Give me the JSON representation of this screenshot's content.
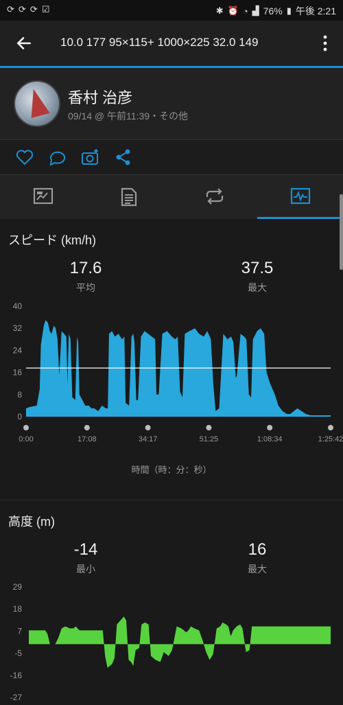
{
  "status_bar": {
    "left_icons": [
      "sync-icon",
      "sync-icon",
      "sync-icon",
      "checkbox-icon"
    ],
    "battery": "76%",
    "time": "午後 2:21"
  },
  "app_bar": {
    "title": "10.0  177   95×115+    1000×225  32.0  149"
  },
  "profile": {
    "name": "香村 治彦",
    "meta": "09/14 @ 午前11:39・その他"
  },
  "actions": [
    "like-icon",
    "comment-icon",
    "add-photo-icon",
    "share-icon"
  ],
  "tabs": [
    {
      "name": "overview",
      "icon": "map-icon",
      "active": false
    },
    {
      "name": "details",
      "icon": "document-icon",
      "active": false
    },
    {
      "name": "laps",
      "icon": "loop-icon",
      "active": false
    },
    {
      "name": "charts",
      "icon": "chart-icon",
      "active": true
    }
  ],
  "colors": {
    "accent": "#1d8fd3",
    "speed_fill": "#28a8dc",
    "elevation_fill": "#59d23f"
  },
  "speed": {
    "title": "スピード (km/h)",
    "avg_value": "17.6",
    "avg_label": "平均",
    "max_value": "37.5",
    "max_label": "最大",
    "x_axis_title": "時間（時：分：秒）"
  },
  "elevation": {
    "title": "高度 (m)",
    "min_value": "-14",
    "min_label": "最小",
    "max_value": "16",
    "max_label": "最大"
  },
  "chart_data": [
    {
      "type": "area",
      "title": "スピード (km/h)",
      "xlabel": "時間（時：分：秒）",
      "ylabel": "",
      "ylim": [
        0,
        40
      ],
      "y_ticks": [
        "40",
        "32",
        "24",
        "16",
        "8",
        "0"
      ],
      "x_ticks": [
        "0:00",
        "17:08",
        "34:17",
        "51:25",
        "1:08:34",
        "1:25:42"
      ],
      "x_seconds_max": 5142,
      "average_line": 17.6,
      "series": [
        {
          "values": [
            [
              0,
              3
            ],
            [
              60,
              3.5
            ],
            [
              180,
              4
            ],
            [
              230,
              10
            ],
            [
              250,
              26
            ],
            [
              300,
              33
            ],
            [
              330,
              35
            ],
            [
              370,
              34
            ],
            [
              400,
              31
            ],
            [
              430,
              30
            ],
            [
              470,
              33
            ],
            [
              500,
              32
            ],
            [
              530,
              28
            ],
            [
              560,
              15
            ],
            [
              600,
              31
            ],
            [
              640,
              30
            ],
            [
              680,
              29
            ],
            [
              700,
              12
            ],
            [
              720,
              30
            ],
            [
              750,
              28
            ],
            [
              780,
              7
            ],
            [
              830,
              6
            ],
            [
              860,
              29
            ],
            [
              880,
              27
            ],
            [
              900,
              8
            ],
            [
              950,
              6
            ],
            [
              1000,
              4
            ],
            [
              1060,
              4
            ],
            [
              1100,
              3
            ],
            [
              1150,
              3
            ],
            [
              1220,
              2
            ],
            [
              1280,
              4
            ],
            [
              1350,
              3
            ],
            [
              1380,
              3
            ],
            [
              1400,
              30
            ],
            [
              1450,
              31
            ],
            [
              1500,
              29
            ],
            [
              1560,
              30
            ],
            [
              1620,
              28
            ],
            [
              1660,
              29
            ],
            [
              1680,
              5
            ],
            [
              1740,
              4
            ],
            [
              1780,
              29
            ],
            [
              1810,
              30
            ],
            [
              1830,
              27
            ],
            [
              1860,
              6
            ],
            [
              1890,
              6
            ],
            [
              1940,
              29
            ],
            [
              2000,
              31
            ],
            [
              2060,
              30
            ],
            [
              2120,
              29
            ],
            [
              2180,
              28
            ],
            [
              2200,
              8
            ],
            [
              2240,
              8
            ],
            [
              2300,
              30
            ],
            [
              2380,
              31
            ],
            [
              2460,
              29
            ],
            [
              2520,
              28
            ],
            [
              2560,
              29
            ],
            [
              2600,
              9
            ],
            [
              2640,
              7
            ],
            [
              2680,
              30
            ],
            [
              2760,
              31
            ],
            [
              2850,
              32
            ],
            [
              2920,
              30
            ],
            [
              3000,
              29
            ],
            [
              3060,
              31
            ],
            [
              3120,
              28
            ],
            [
              3160,
              12
            ],
            [
              3200,
              2
            ],
            [
              3260,
              3
            ],
            [
              3330,
              30
            ],
            [
              3400,
              28
            ],
            [
              3460,
              29
            ],
            [
              3500,
              27
            ],
            [
              3540,
              14
            ],
            [
              3560,
              15
            ],
            [
              3620,
              30
            ],
            [
              3680,
              29
            ],
            [
              3720,
              28
            ],
            [
              3760,
              8
            ],
            [
              3800,
              7
            ],
            [
              3830,
              28
            ],
            [
              3900,
              31
            ],
            [
              3960,
              32
            ],
            [
              4020,
              30
            ],
            [
              4060,
              16
            ],
            [
              4120,
              12
            ],
            [
              4200,
              8
            ],
            [
              4260,
              4
            ],
            [
              4330,
              2
            ],
            [
              4400,
              1
            ],
            [
              4460,
              1
            ],
            [
              4520,
              2
            ],
            [
              4580,
              3
            ],
            [
              4650,
              2
            ],
            [
              4720,
              1
            ],
            [
              4800,
              0.5
            ],
            [
              5142,
              0.5
            ]
          ]
        }
      ]
    },
    {
      "type": "area",
      "title": "高度 (m)",
      "xlabel": "",
      "ylabel": "",
      "ylim": [
        -27,
        29
      ],
      "y_ticks": [
        "29",
        "18",
        "7",
        "-5",
        "-16",
        "-27"
      ],
      "x_seconds_max": 5142,
      "series": [
        {
          "values": [
            [
              0,
              7
            ],
            [
              280,
              7
            ],
            [
              320,
              5
            ],
            [
              360,
              0
            ],
            [
              450,
              0
            ],
            [
              500,
              3
            ],
            [
              560,
              8
            ],
            [
              620,
              9
            ],
            [
              700,
              8
            ],
            [
              760,
              8
            ],
            [
              800,
              9
            ],
            [
              860,
              7
            ],
            [
              1000,
              7
            ],
            [
              1260,
              7
            ],
            [
              1300,
              -6
            ],
            [
              1340,
              -12
            ],
            [
              1420,
              -10
            ],
            [
              1460,
              -7
            ],
            [
              1500,
              10
            ],
            [
              1560,
              12
            ],
            [
              1620,
              14
            ],
            [
              1660,
              12
            ],
            [
              1700,
              -8
            ],
            [
              1740,
              -9
            ],
            [
              1780,
              -11
            ],
            [
              1820,
              -3
            ],
            [
              1880,
              -2
            ],
            [
              1920,
              10
            ],
            [
              1980,
              11
            ],
            [
              2040,
              10
            ],
            [
              2080,
              -6
            ],
            [
              2160,
              -8
            ],
            [
              2240,
              -9
            ],
            [
              2300,
              -4
            ],
            [
              2380,
              -6
            ],
            [
              2440,
              -3
            ],
            [
              2520,
              9
            ],
            [
              2600,
              8
            ],
            [
              2680,
              6
            ],
            [
              2720,
              7
            ],
            [
              2760,
              9
            ],
            [
              2820,
              8
            ],
            [
              2900,
              7
            ],
            [
              2960,
              2
            ],
            [
              3020,
              -4
            ],
            [
              3080,
              -8
            ],
            [
              3140,
              -5
            ],
            [
              3200,
              8
            ],
            [
              3260,
              9
            ],
            [
              3300,
              11
            ],
            [
              3360,
              10
            ],
            [
              3400,
              9
            ],
            [
              3440,
              4
            ],
            [
              3480,
              7
            ],
            [
              3540,
              9
            ],
            [
              3600,
              10
            ],
            [
              3640,
              8
            ],
            [
              3700,
              -4
            ],
            [
              3760,
              -3
            ],
            [
              3800,
              9
            ],
            [
              3880,
              9
            ],
            [
              3980,
              9
            ],
            [
              4100,
              9
            ],
            [
              4300,
              9
            ],
            [
              4600,
              9
            ],
            [
              5142,
              9
            ]
          ]
        }
      ]
    }
  ]
}
